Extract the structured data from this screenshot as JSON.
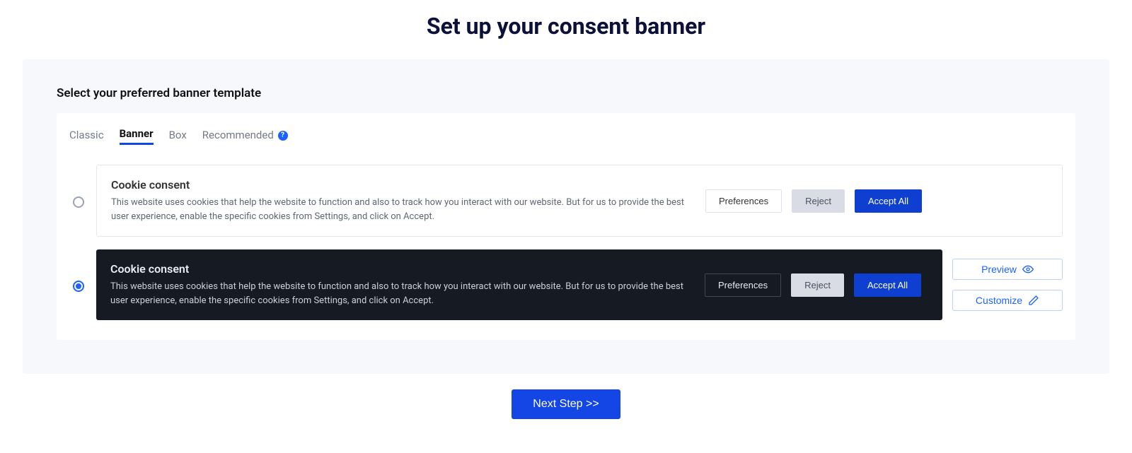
{
  "page": {
    "title": "Set up your consent banner",
    "section_label": "Select your preferred banner template"
  },
  "tabs": {
    "classic": "Classic",
    "banner": "Banner",
    "box": "Box",
    "recommended": "Recommended"
  },
  "options": {
    "light": {
      "title": "Cookie consent",
      "desc": "This website uses cookies that help the website to function and also to track how you interact with our website. But for us to provide the best user experience, enable the specific cookies from Settings, and click on Accept.",
      "pref_label": "Preferences",
      "reject_label": "Reject",
      "accept_label": "Accept All"
    },
    "dark": {
      "title": "Cookie consent",
      "desc": "This website uses cookies that help the website to function and also to track how you interact with our website. But for us to provide the best user experience, enable the specific cookies from Settings, and click on Accept.",
      "pref_label": "Preferences",
      "reject_label": "Reject",
      "accept_label": "Accept All"
    }
  },
  "side": {
    "preview": "Preview",
    "customize": "Customize"
  },
  "footer": {
    "next": "Next Step >>"
  }
}
